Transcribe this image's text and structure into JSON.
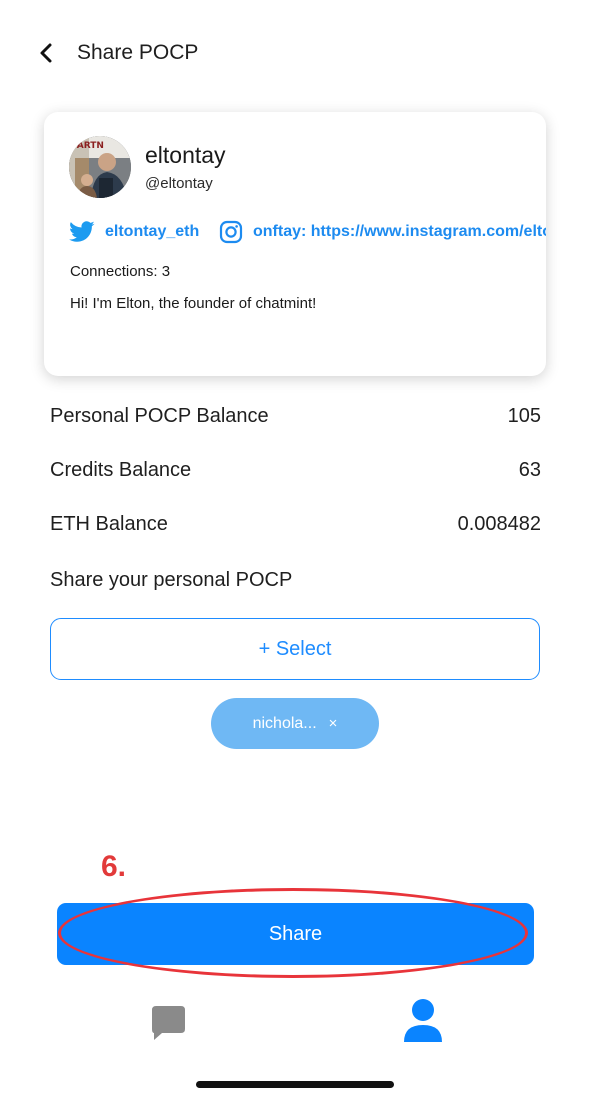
{
  "header": {
    "title": "Share POCP",
    "back_icon": "chevron-left-icon"
  },
  "profile": {
    "display_name": "eltontay",
    "handle": "@eltontay",
    "twitter": "eltontay_eth",
    "instagram": "onftay: https://www.instagram.com/elton",
    "connections": "Connections: 3",
    "bio": "Hi! I'm Elton, the founder of chatmint!",
    "avatar_banner_text": "PARTN"
  },
  "balances": [
    {
      "label": "Personal POCP Balance",
      "value": "105"
    },
    {
      "label": "Credits Balance",
      "value": "63"
    },
    {
      "label": "ETH Balance",
      "value": "0.008482"
    }
  ],
  "share_section": {
    "label": "Share your personal POCP",
    "select_label": "+ Select",
    "selected_chip": "nichola...",
    "chip_remove": "×"
  },
  "annotation": {
    "step": "6."
  },
  "share_button": "Share",
  "tabbar": {
    "chat_icon": "chat-bubble-icon",
    "profile_icon": "user-icon"
  },
  "colors": {
    "accent": "#0a84ff",
    "chip": "#6fb8f4",
    "annotation": "#e8343a",
    "twitter": "#1d8bf0"
  }
}
